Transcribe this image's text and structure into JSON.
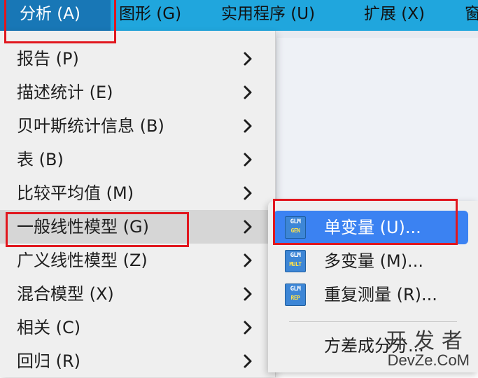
{
  "menubar": {
    "items": [
      {
        "label": "分析 (A)"
      },
      {
        "label": "图形 (G)"
      },
      {
        "label": "实用程序 (U)"
      },
      {
        "label": "扩展 (X)"
      },
      {
        "label": "窗"
      }
    ],
    "accent_color": "#20a6dd",
    "active_color": "#1877b6"
  },
  "analyze_menu": {
    "items": [
      {
        "label": "报告 (P)"
      },
      {
        "label": "描述统计 (E)"
      },
      {
        "label": "贝叶斯统计信息 (B)"
      },
      {
        "label": "表 (B)"
      },
      {
        "label": "比较平均值 (M)"
      },
      {
        "label": "一般线性模型 (G)"
      },
      {
        "label": "广义线性模型 (Z)"
      },
      {
        "label": "混合模型 (X)"
      },
      {
        "label": "相关 (C)"
      },
      {
        "label": "回归 (R)"
      }
    ],
    "highlight_color": "#d6d6d6"
  },
  "glm_submenu": {
    "items": [
      {
        "label": "单变量 (U)...",
        "icon_top": "GLM",
        "icon_bottom": "GEN"
      },
      {
        "label": "多变量 (M)...",
        "icon_top": "GLM",
        "icon_bottom": "MULT"
      },
      {
        "label": "重复测量 (R)...",
        "icon_top": "GLM",
        "icon_bottom": "REP"
      },
      {
        "label": "方差成分分..."
      }
    ],
    "selected_color": "#3b82f2"
  },
  "annotation_color": "#e1171e",
  "watermark": {
    "top": "开发者",
    "bottom": "DevZe.CoM"
  }
}
